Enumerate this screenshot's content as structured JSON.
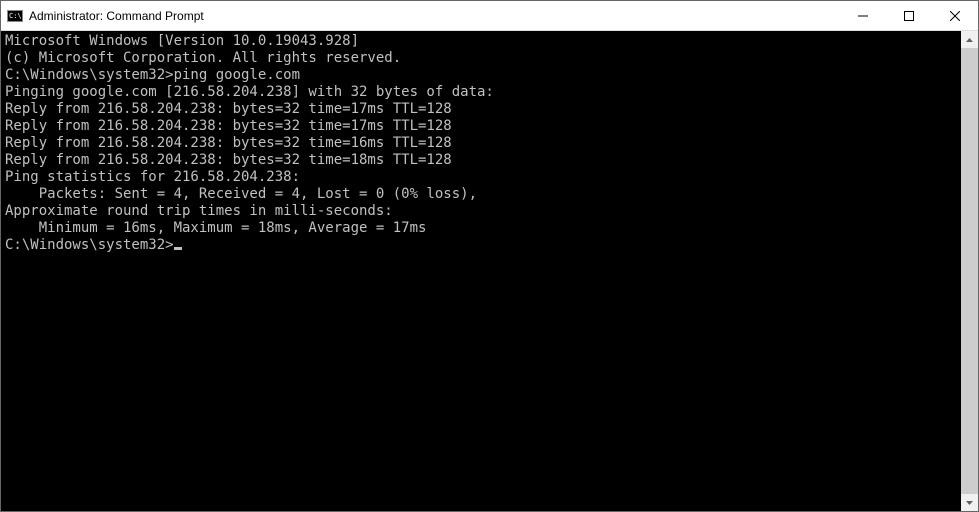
{
  "window": {
    "title": "Administrator: Command Prompt"
  },
  "terminal": {
    "lines": [
      "Microsoft Windows [Version 10.0.19043.928]",
      "(c) Microsoft Corporation. All rights reserved.",
      "",
      "C:\\Windows\\system32>ping google.com",
      "",
      "Pinging google.com [216.58.204.238] with 32 bytes of data:",
      "Reply from 216.58.204.238: bytes=32 time=17ms TTL=128",
      "Reply from 216.58.204.238: bytes=32 time=17ms TTL=128",
      "Reply from 216.58.204.238: bytes=32 time=16ms TTL=128",
      "Reply from 216.58.204.238: bytes=32 time=18ms TTL=128",
      "",
      "Ping statistics for 216.58.204.238:",
      "    Packets: Sent = 4, Received = 4, Lost = 0 (0% loss),",
      "Approximate round trip times in milli-seconds:",
      "    Minimum = 16ms, Maximum = 18ms, Average = 17ms",
      "",
      "C:\\Windows\\system32>"
    ]
  }
}
